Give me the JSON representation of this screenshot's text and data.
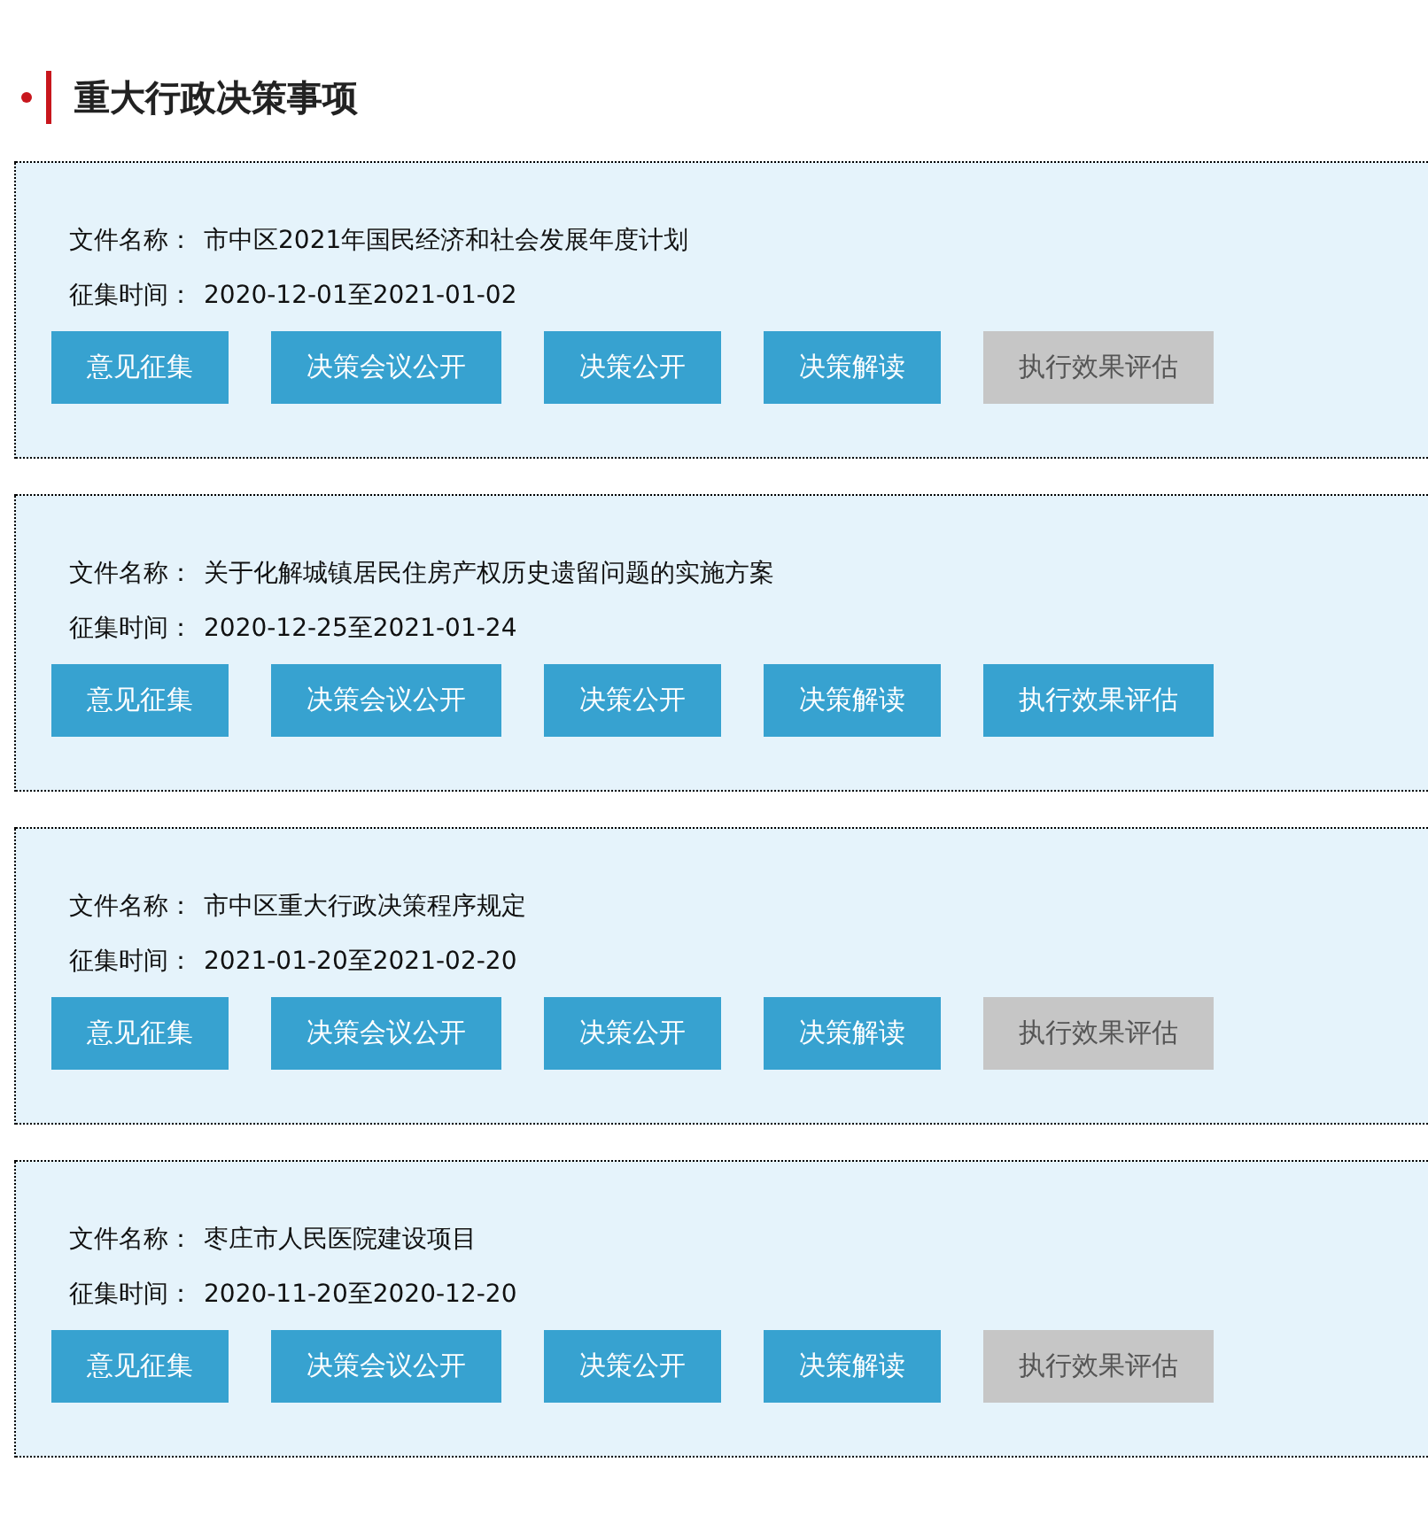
{
  "section": {
    "title": "重大行政决策事项"
  },
  "items": [
    {
      "name_label": "文件名称：",
      "name": "市中区2021年国民经济和社会发展年度计划",
      "period_label": "征集时间：",
      "period": "2020-12-01至2021-01-02",
      "buttons": [
        {
          "label": "意见征集",
          "disabled": false
        },
        {
          "label": "决策会议公开",
          "disabled": false
        },
        {
          "label": "决策公开",
          "disabled": false
        },
        {
          "label": "决策解读",
          "disabled": false
        },
        {
          "label": "执行效果评估",
          "disabled": true
        }
      ]
    },
    {
      "name_label": "文件名称：",
      "name": "关于化解城镇居民住房产权历史遗留问题的实施方案",
      "period_label": "征集时间：",
      "period": "2020-12-25至2021-01-24",
      "buttons": [
        {
          "label": "意见征集",
          "disabled": false
        },
        {
          "label": "决策会议公开",
          "disabled": false
        },
        {
          "label": "决策公开",
          "disabled": false
        },
        {
          "label": "决策解读",
          "disabled": false
        },
        {
          "label": "执行效果评估",
          "disabled": false
        }
      ]
    },
    {
      "name_label": "文件名称：",
      "name": "市中区重大行政决策程序规定",
      "period_label": "征集时间：",
      "period": "2021-01-20至2021-02-20",
      "buttons": [
        {
          "label": "意见征集",
          "disabled": false
        },
        {
          "label": "决策会议公开",
          "disabled": false
        },
        {
          "label": "决策公开",
          "disabled": false
        },
        {
          "label": "决策解读",
          "disabled": false
        },
        {
          "label": "执行效果评估",
          "disabled": true
        }
      ]
    },
    {
      "name_label": "文件名称：",
      "name": "枣庄市人民医院建设项目",
      "period_label": "征集时间：",
      "period": "2020-11-20至2020-12-20",
      "buttons": [
        {
          "label": "意见征集",
          "disabled": false
        },
        {
          "label": "决策会议公开",
          "disabled": false
        },
        {
          "label": "决策公开",
          "disabled": false
        },
        {
          "label": "决策解读",
          "disabled": false
        },
        {
          "label": "执行效果评估",
          "disabled": true
        }
      ]
    }
  ]
}
